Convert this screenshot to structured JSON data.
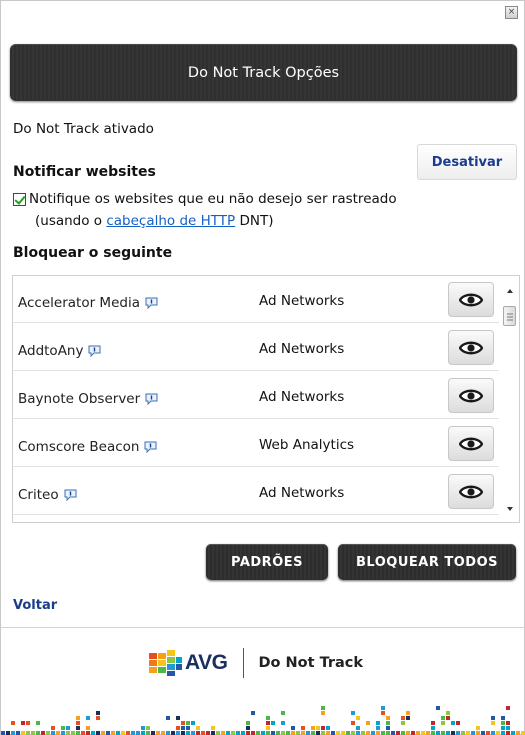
{
  "window": {
    "close_glyph": "×"
  },
  "header": {
    "title": "Do Not Track Opções"
  },
  "status": {
    "text": "Do Not Track ativado",
    "disable_label": "Desativar"
  },
  "notify": {
    "section_title": "Notificar websites",
    "checkbox_label": "Notifique os websites que eu não desejo ser rastreado",
    "checked": true,
    "note_prefix": "(usando o ",
    "note_link": "cabeçalho de HTTP",
    "note_suffix": " DNT)"
  },
  "block": {
    "section_title": "Bloquear o seguinte",
    "rows": [
      {
        "name": "Accelerator Media",
        "category": "Ad Networks",
        "icon": "eye-icon"
      },
      {
        "name": "AddtoAny",
        "category": "Ad Networks",
        "icon": "eye-icon"
      },
      {
        "name": "Baynote Observer",
        "category": "Ad Networks",
        "icon": "eye-icon"
      },
      {
        "name": "Comscore Beacon",
        "category": "Web Analytics",
        "icon": "eye-icon"
      },
      {
        "name": "Criteo",
        "category": "Ad Networks",
        "icon": "eye-icon"
      }
    ]
  },
  "buttons": {
    "defaults_label": "PADRÕES",
    "block_all_label": "BLOQUEAR TODOS"
  },
  "nav": {
    "back_label": "Voltar"
  },
  "footer": {
    "brand": "AVG",
    "product": "Do Not Track"
  },
  "colors": {
    "link_blue": "#1560c6",
    "header_dark": "#2f2f2f",
    "label_blue": "#1a3c8c",
    "avg_navy": "#1a2f5e"
  }
}
